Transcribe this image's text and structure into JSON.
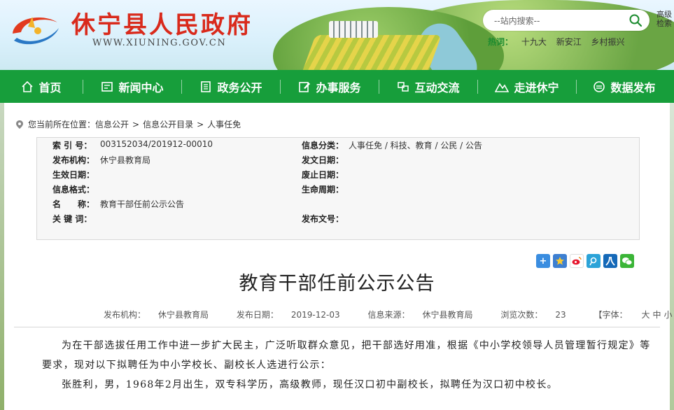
{
  "header": {
    "site_title": "休宁县人民政府",
    "site_url": "WWW.XIUNING.GOV.CN",
    "search_placeholder": "--站内搜索--",
    "advanced_search": "高级检索",
    "hot_label": "热词：",
    "hot_words": [
      "十九大",
      "新安江",
      "乡村振兴"
    ]
  },
  "nav": {
    "items": [
      {
        "label": "首页",
        "icon": "home-icon"
      },
      {
        "label": "新闻中心",
        "icon": "news-icon"
      },
      {
        "label": "政务公开",
        "icon": "document-icon"
      },
      {
        "label": "办事服务",
        "icon": "edit-icon"
      },
      {
        "label": "互动交流",
        "icon": "chat-icon"
      },
      {
        "label": "走进休宁",
        "icon": "mountain-icon"
      },
      {
        "label": "数据发布",
        "icon": "data-icon"
      }
    ],
    "accent_color": "#179e3b"
  },
  "breadcrumb": {
    "prefix": "您当前所在位置：",
    "items": [
      "信息公开",
      "信息公开目录",
      "人事任免"
    ],
    "separator": ">"
  },
  "info": {
    "index_label": "索 引 号：",
    "index_value": "003152034/201912-00010",
    "category_label": "信息分类：",
    "category_value": "人事任免 / 科技、教育 / 公民 / 公告",
    "publisher_label": "发布机构：",
    "publisher_value": "休宁县教育局",
    "issue_date_label": "发文日期：",
    "issue_date_value": "",
    "effective_label": "生效日期：",
    "effective_value": "",
    "abolish_label": "废止日期：",
    "abolish_value": "",
    "format_label": "信息格式：",
    "format_value": "",
    "lifecycle_label": "生命周期：",
    "lifecycle_value": "",
    "name_label": "名　　称：",
    "name_value": "教育干部任前公示公告",
    "keywords_label": "关 键 词：",
    "keywords_value": "",
    "doc_no_label": "发布文号：",
    "doc_no_value": ""
  },
  "article": {
    "title": "教育干部任前公示公告",
    "meta": {
      "publisher_label": "发布机构：",
      "publisher": "休宁县教育局",
      "date_label": "发布日期：",
      "date": "2019-12-03",
      "source_label": "信息来源：",
      "source": "休宁县教育局",
      "views_label": "浏览次数：",
      "views": "23",
      "font_label": "【字体：",
      "font_sizes": [
        "大",
        "中",
        "小"
      ],
      "font_close": "】"
    },
    "paragraphs": [
      "为在干部选拔任用工作中进一步扩大民主，广泛听取群众意见，把干部选好用准，根据《中小学校领导人员管理暂行规定》等要求，现对以下拟聘任为中小学校长、副校长人选进行公示：",
      "张胜利，男，1968年2月出生，双专科学历，高级教师，现任汉口初中副校长，拟聘任为汉口初中校长。"
    ]
  },
  "share_icons": [
    "plus-icon",
    "star-icon",
    "weibo-icon",
    "tencent-weibo-icon",
    "renren-icon",
    "wechat-icon"
  ]
}
